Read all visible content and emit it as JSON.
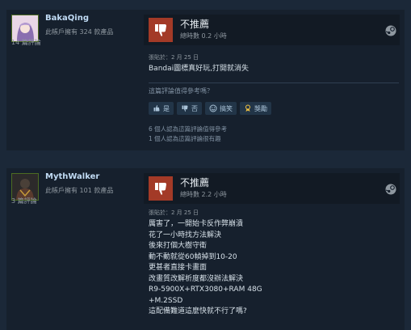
{
  "reviews": [
    {
      "username": "BakaQing",
      "owned": "此帳戶擁有 324 款產品",
      "num_reviews": "14 篇評論",
      "verdict": "不推薦",
      "hours": "總時數 0.2 小時",
      "posted": "張貼於：2 月 25 日",
      "text": "Bandai圖標真好玩,打開就消失",
      "helpful_question": "這篇評論值得參考嗎？",
      "buttons": {
        "yes": "是",
        "no": "否",
        "funny": "搞笑",
        "award": "獎勵"
      },
      "stats": [
        "6 個人認為這篇評論值得參考",
        "1 個人認為這篇評論很有趣"
      ]
    },
    {
      "username": "MythWalker",
      "owned": "此帳戶擁有 101 款產品",
      "num_reviews": "3 篇評論",
      "verdict": "不推薦",
      "hours": "總時數 2.2 小時",
      "posted": "張貼於：2 月 25 日",
      "text_lines": [
        "厲害了，一開始卡反作弊崩潰",
        "花了一小時找方法解決",
        "後來打個大樹守衛",
        "動不動就從60幀掉到10-20",
        "更甚者直接卡畫面",
        "改畫質改解析度都沒辦法解決",
        "R9-5900X+RTX3080+RAM 48G",
        "+M.2SSD",
        "這配備難道這麼快就不行了嗎?"
      ]
    }
  ],
  "colors": {
    "background": "#1b2838",
    "panel": "#16202d",
    "thumb_down": "#a33a27",
    "username": "#c1dbf4"
  },
  "icons": [
    "thumbs-down-icon",
    "steam-icon",
    "thumbs-up-icon",
    "smile-icon",
    "award-icon"
  ]
}
